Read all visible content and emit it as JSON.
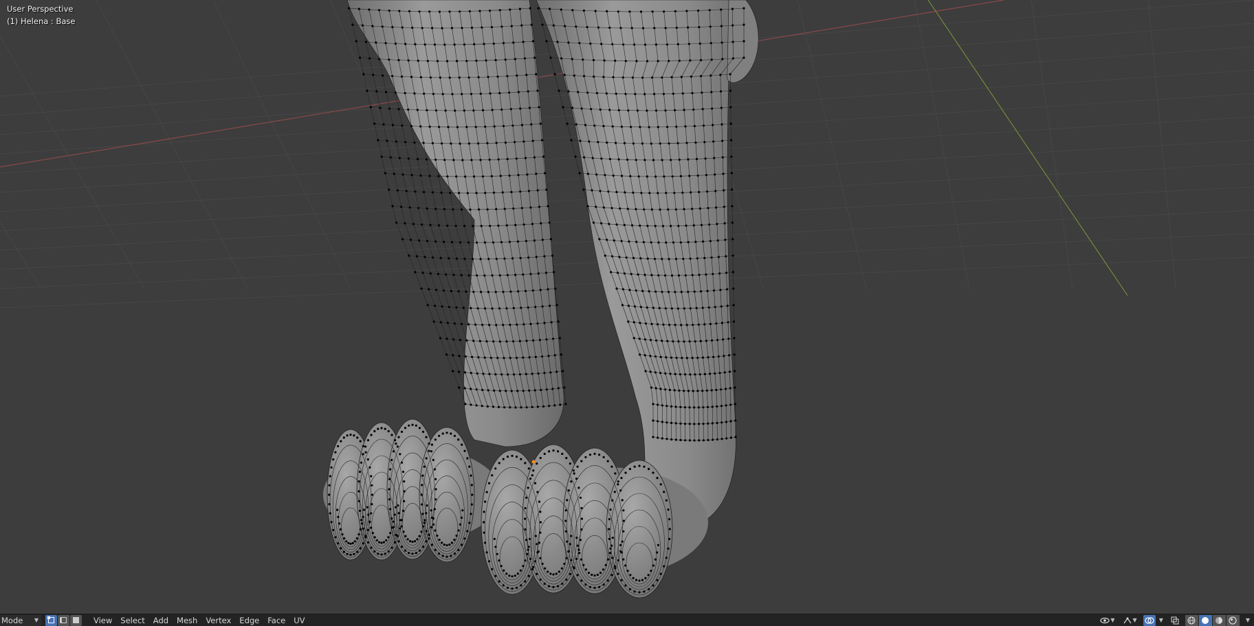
{
  "viewport": {
    "perspective_label": "User Perspective",
    "object_label": "(1) Helena : Base"
  },
  "toolbar": {
    "mode_label": "Mode",
    "select_modes": [
      "vertex-select-icon",
      "edge-select-icon",
      "face-select-icon"
    ],
    "active_select_mode": 0,
    "menus": [
      "View",
      "Select",
      "Add",
      "Mesh",
      "Vertex",
      "Edge",
      "Face",
      "UV"
    ],
    "right_icons": [
      "visibility-icon",
      "gizmo-icon",
      "overlay-icon",
      "xray-icon"
    ],
    "shading_modes": [
      "wireframe-shading-icon",
      "solid-shading-icon",
      "material-shading-icon",
      "rendered-shading-icon"
    ],
    "active_shading_mode": 1
  },
  "colors": {
    "background": "#3d3d3d",
    "grid": "#4a4a4a",
    "x_axis": "#9a4a4a",
    "y_axis": "#7a9a3a",
    "mesh_fill": "#8c8c8c",
    "vertex": "#000000",
    "active_vertex": "#ff8c1a",
    "accent": "#4772b3"
  }
}
